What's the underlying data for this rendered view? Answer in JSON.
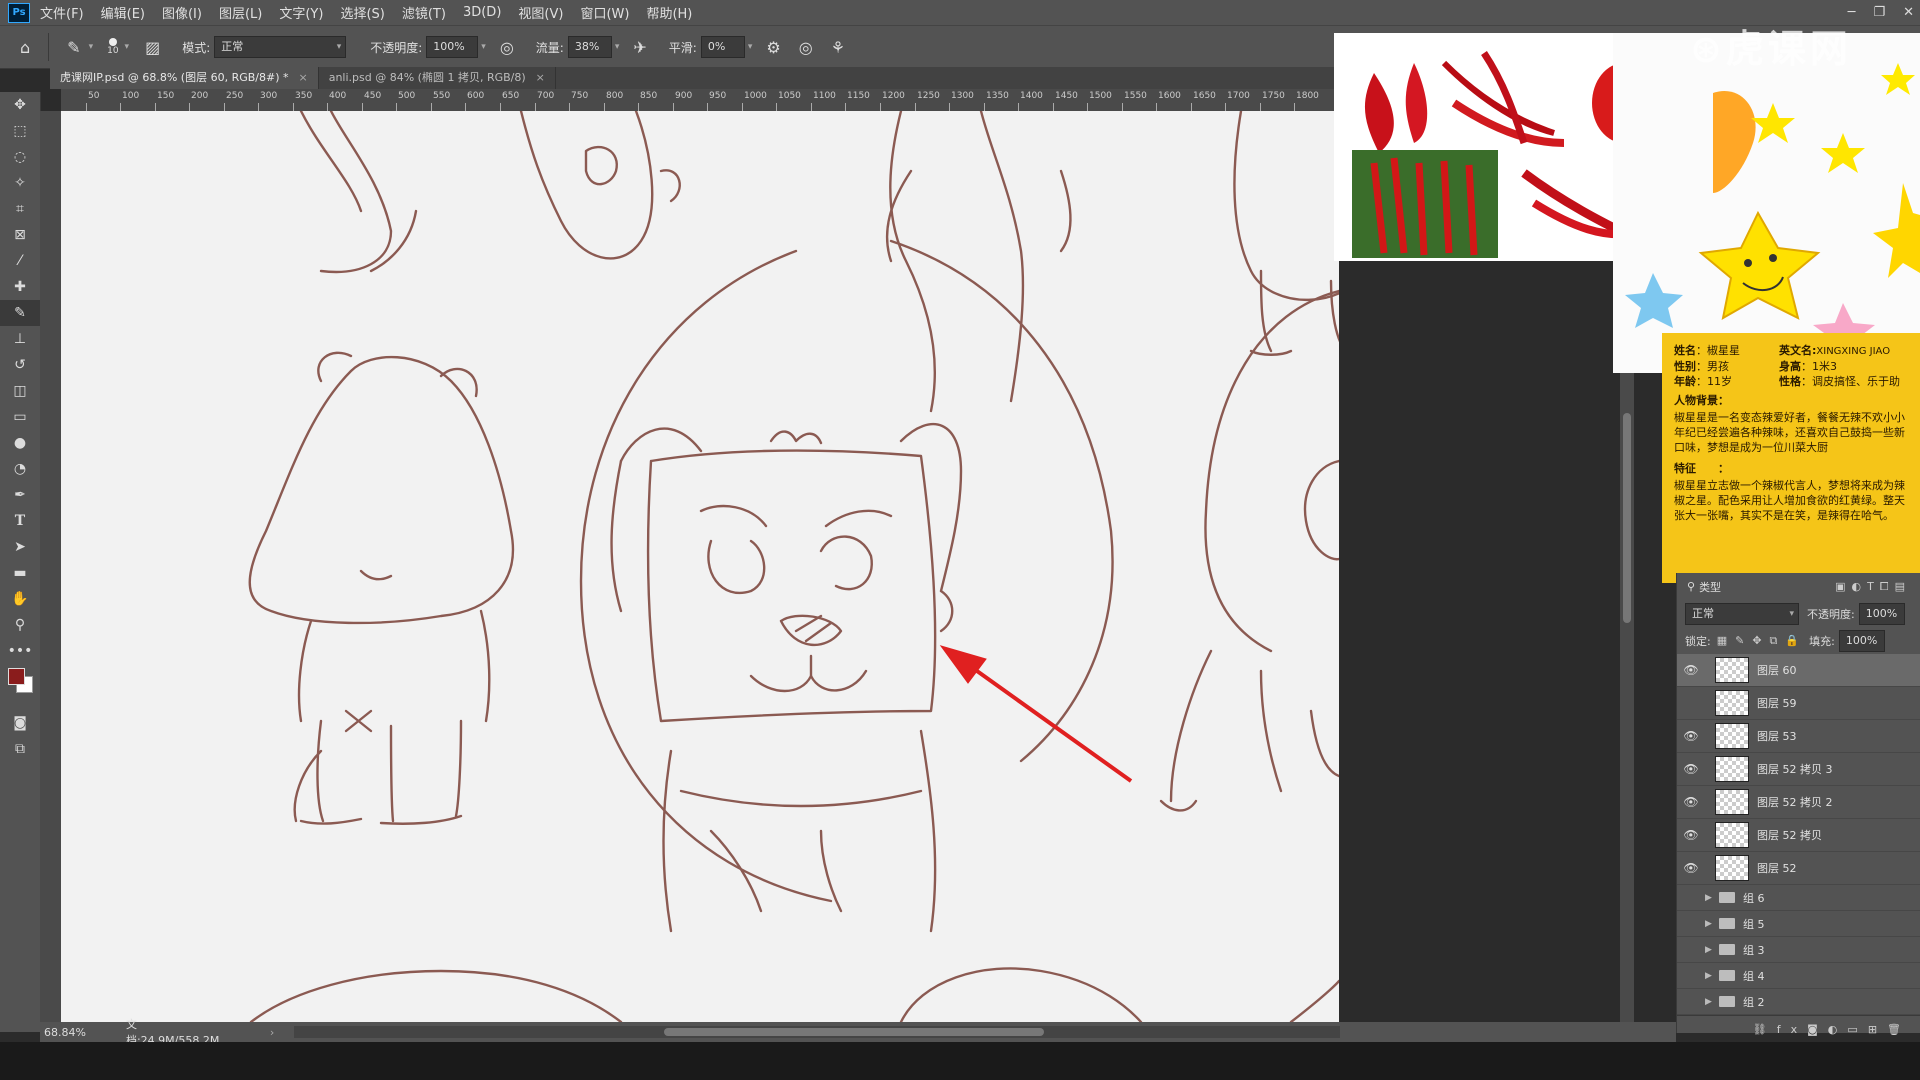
{
  "app": {
    "logo": "Ps"
  },
  "menubar": {
    "items": [
      "文件(F)",
      "编辑(E)",
      "图像(I)",
      "图层(L)",
      "文字(Y)",
      "选择(S)",
      "滤镜(T)",
      "3D(D)",
      "视图(V)",
      "窗口(W)",
      "帮助(H)"
    ]
  },
  "options": {
    "brush_size": "10",
    "mode_label": "模式:",
    "mode_value": "正常",
    "opacity_label": "不透明度:",
    "opacity_value": "100%",
    "flow_label": "流量:",
    "flow_value": "38%",
    "smooth_label": "平滑:",
    "smooth_value": "0%"
  },
  "tabs": [
    {
      "label": "虎课网IP.psd @ 68.8% (图层 60, RGB/8#) *",
      "close": "×"
    },
    {
      "label": "anli.psd @ 84% (椭圆 1 拷贝, RGB/8)",
      "close": "×"
    }
  ],
  "ruler": {
    "ticks": [
      "50",
      "100",
      "150",
      "200",
      "250",
      "300",
      "350",
      "400",
      "450",
      "500",
      "550",
      "600",
      "650",
      "700",
      "750",
      "800",
      "850",
      "900",
      "950",
      "1000",
      "1050",
      "1100",
      "1150",
      "1200",
      "1250",
      "1300",
      "1350",
      "1400",
      "1450",
      "1500",
      "1550",
      "1600",
      "1650",
      "1700",
      "1750",
      "1800"
    ]
  },
  "info_card": {
    "name_k": "姓名",
    "name_v": "：椒星星",
    "en_k": "英文名:",
    "en_v": "XINGXING JIAO",
    "gender_k": "性别",
    "gender_v": "：男孩",
    "height_k": "身高",
    "height_v": "：1米3",
    "age_k": "年龄",
    "age_v": "：11岁",
    "trait_k": "性格",
    "trait_v": "：调皮搞怪、乐于助",
    "bg_k": "人物背景：",
    "bg_text": "椒星星是一名变态辣爱好者，餐餐无辣不欢小小年纪已经尝遍各种辣味，还喜欢自己鼓捣一些新口味，梦想是成为一位川菜大厨",
    "feat_k": "特征　　：",
    "feat_text": "椒星星立志做一个辣椒代言人，梦想将来成为辣椒之星。配色采用让人增加食欲的红黄绿。整天张大一张嘴，其实不是在笑，是辣得在哈气。"
  },
  "layers": {
    "filter_label": "类型",
    "blend_mode": "正常",
    "opacity_label": "不透明度:",
    "opacity_value": "100%",
    "lock_label": "锁定:",
    "fill_label": "填充:",
    "fill_value": "100%",
    "items": [
      {
        "name": "图层 60",
        "visible": true,
        "selected": true
      },
      {
        "name": "图层 59",
        "visible": false,
        "selected": false
      },
      {
        "name": "图层 53",
        "visible": true,
        "selected": false
      },
      {
        "name": "图层 52 拷贝 3",
        "visible": true,
        "selected": false
      },
      {
        "name": "图层 52 拷贝 2",
        "visible": true,
        "selected": false
      },
      {
        "name": "图层 52 拷贝",
        "visible": true,
        "selected": false
      },
      {
        "name": "图层 52",
        "visible": true,
        "selected": false
      }
    ],
    "groups": [
      "组 6",
      "组 5",
      "组 3",
      "组 4",
      "组 2"
    ]
  },
  "status": {
    "zoom": "68.84%",
    "doc": "文档:24.9M/558.2M"
  },
  "colors": {
    "foreground": "#8a1c1c",
    "background": "#ffffff",
    "sketch_line": "#8b5a52",
    "arrow": "#e02020",
    "card": "#f5c518"
  }
}
